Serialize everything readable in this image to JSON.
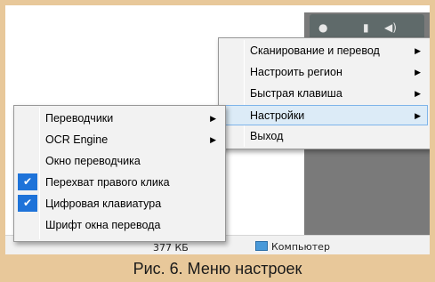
{
  "tray": {
    "icons": [
      "tray-app-icon",
      "battery-icon",
      "volume-icon"
    ]
  },
  "statusbar": {
    "size": "377 КБ",
    "folder": "Компьютер"
  },
  "main_menu": {
    "items": [
      {
        "label": "Сканирование и перевод",
        "has_submenu": true
      },
      {
        "label": "Настроить регион",
        "has_submenu": true
      },
      {
        "label": "Быстрая клавиша",
        "has_submenu": true
      },
      {
        "label": "Настройки",
        "has_submenu": true,
        "highlighted": true
      },
      {
        "label": "Выход",
        "has_submenu": false
      }
    ]
  },
  "settings_menu": {
    "items": [
      {
        "label": "Переводчики",
        "has_submenu": true,
        "checked": false
      },
      {
        "label": "OCR Engine",
        "has_submenu": true,
        "checked": false
      },
      {
        "label": "Окно переводчика",
        "has_submenu": false,
        "checked": false
      },
      {
        "label": "Перехват правого клика",
        "has_submenu": false,
        "checked": true
      },
      {
        "label": "Цифровая клавиатура",
        "has_submenu": false,
        "checked": true
      },
      {
        "label": "Шрифт окна перевода",
        "has_submenu": false,
        "checked": false
      }
    ]
  },
  "caption": "Рис.  6. Меню настроек",
  "colors": {
    "frame": "#e8c89a",
    "highlight_bg": "#dcebf7",
    "highlight_border": "#7eb4ea",
    "check_bg": "#1e73d9"
  }
}
